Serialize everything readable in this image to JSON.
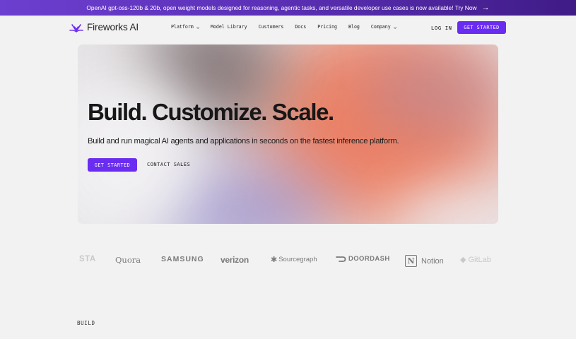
{
  "banner": {
    "text": "OpenAI gpt-oss-120b & 20b, open weight models designed for reasoning, agentic tasks, and versatile developer use cases is now available! Try Now",
    "arrow_icon": "arrow-right-icon"
  },
  "nav": {
    "brand": "Fireworks AI",
    "logo_icon": "fireworks-logo-icon",
    "items": [
      {
        "label": "Platform",
        "has_dropdown": true
      },
      {
        "label": "Model Library",
        "has_dropdown": false
      },
      {
        "label": "Customers",
        "has_dropdown": false
      },
      {
        "label": "Docs",
        "has_dropdown": false
      },
      {
        "label": "Pricing",
        "has_dropdown": false
      },
      {
        "label": "Blog",
        "has_dropdown": false
      },
      {
        "label": "Company",
        "has_dropdown": true
      }
    ],
    "login_label": "LOG IN",
    "cta_label": "GET STARTED"
  },
  "hero": {
    "title": "Build. Customize. Scale.",
    "subtitle": "Build and run magical AI agents and applications in seconds on the fastest inference platform.",
    "primary_cta": "GET STARTED",
    "secondary_cta": "CONTACT SALES"
  },
  "customers": {
    "logos": [
      "STA",
      "Quora",
      "SAMSUNG",
      "verizon",
      "Sourcegraph",
      "DOORDASH",
      "Notion",
      "GitLab"
    ]
  },
  "section": {
    "label": "BUILD"
  },
  "colors": {
    "accent": "#6a2cf0",
    "banner": "#5a2fb4",
    "background": "#f2f2f2"
  }
}
